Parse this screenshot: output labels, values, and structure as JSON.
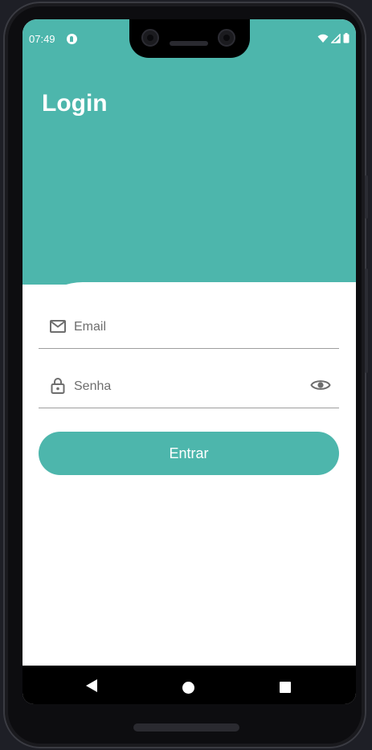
{
  "status_bar": {
    "time": "07:49",
    "icons": [
      "app-notification-icon",
      "wifi-icon",
      "signal-icon",
      "battery-icon"
    ]
  },
  "header": {
    "title": "Login"
  },
  "form": {
    "email": {
      "placeholder": "Email",
      "icon": "mail-icon"
    },
    "password": {
      "placeholder": "Senha",
      "icon": "lock-icon",
      "toggle_icon": "eye-icon"
    },
    "submit_label": "Entrar"
  },
  "navigation_bar": {
    "icons": [
      "back-icon",
      "home-icon",
      "recents-icon"
    ]
  },
  "colors": {
    "accent": "#4db6ac",
    "background": "#ffffff",
    "frame": "#0d0d10"
  }
}
